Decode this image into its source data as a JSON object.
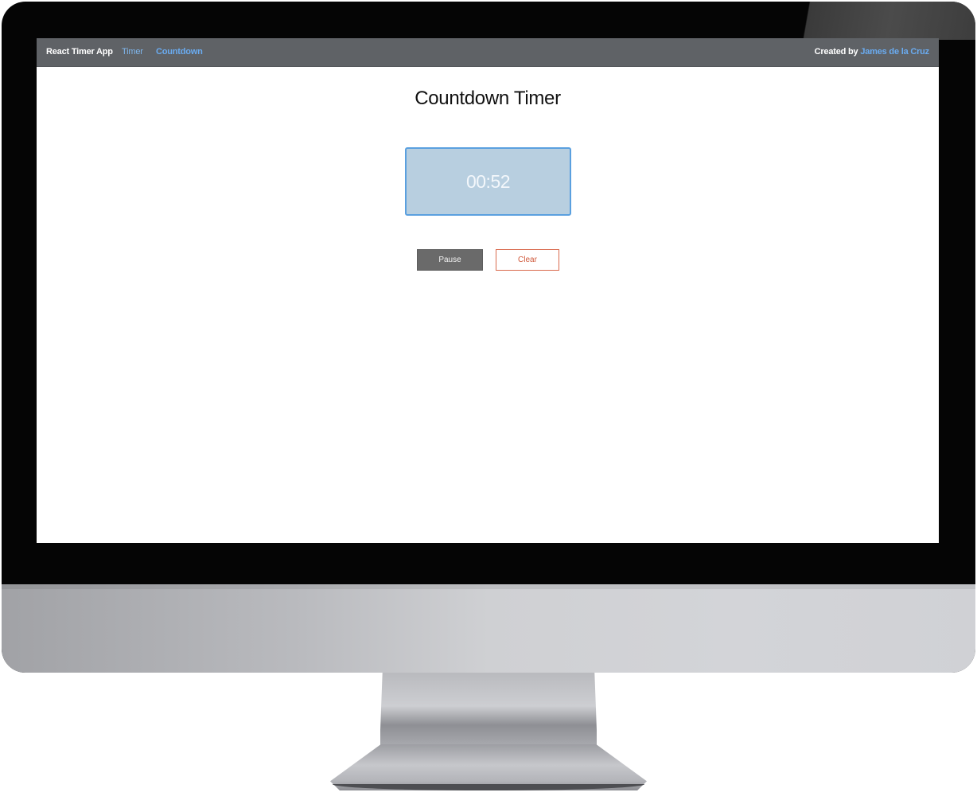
{
  "navbar": {
    "brand": "React Timer App",
    "links": [
      {
        "label": "Timer"
      },
      {
        "label": "Countdown"
      }
    ],
    "credit_prefix": "Created by",
    "credit_name": "James de la Cruz"
  },
  "main": {
    "title": "Countdown Timer",
    "clock_value": "00:52",
    "buttons": {
      "pause_label": "Pause",
      "clear_label": "Clear"
    }
  },
  "colors": {
    "navbar_bg": "#5f6266",
    "link": "#6aabf0",
    "clock_bg": "#b8cfe0",
    "clock_border": "#5aa0df",
    "pause_bg": "#6a6a6a",
    "clear_accent": "#d05a3c"
  }
}
